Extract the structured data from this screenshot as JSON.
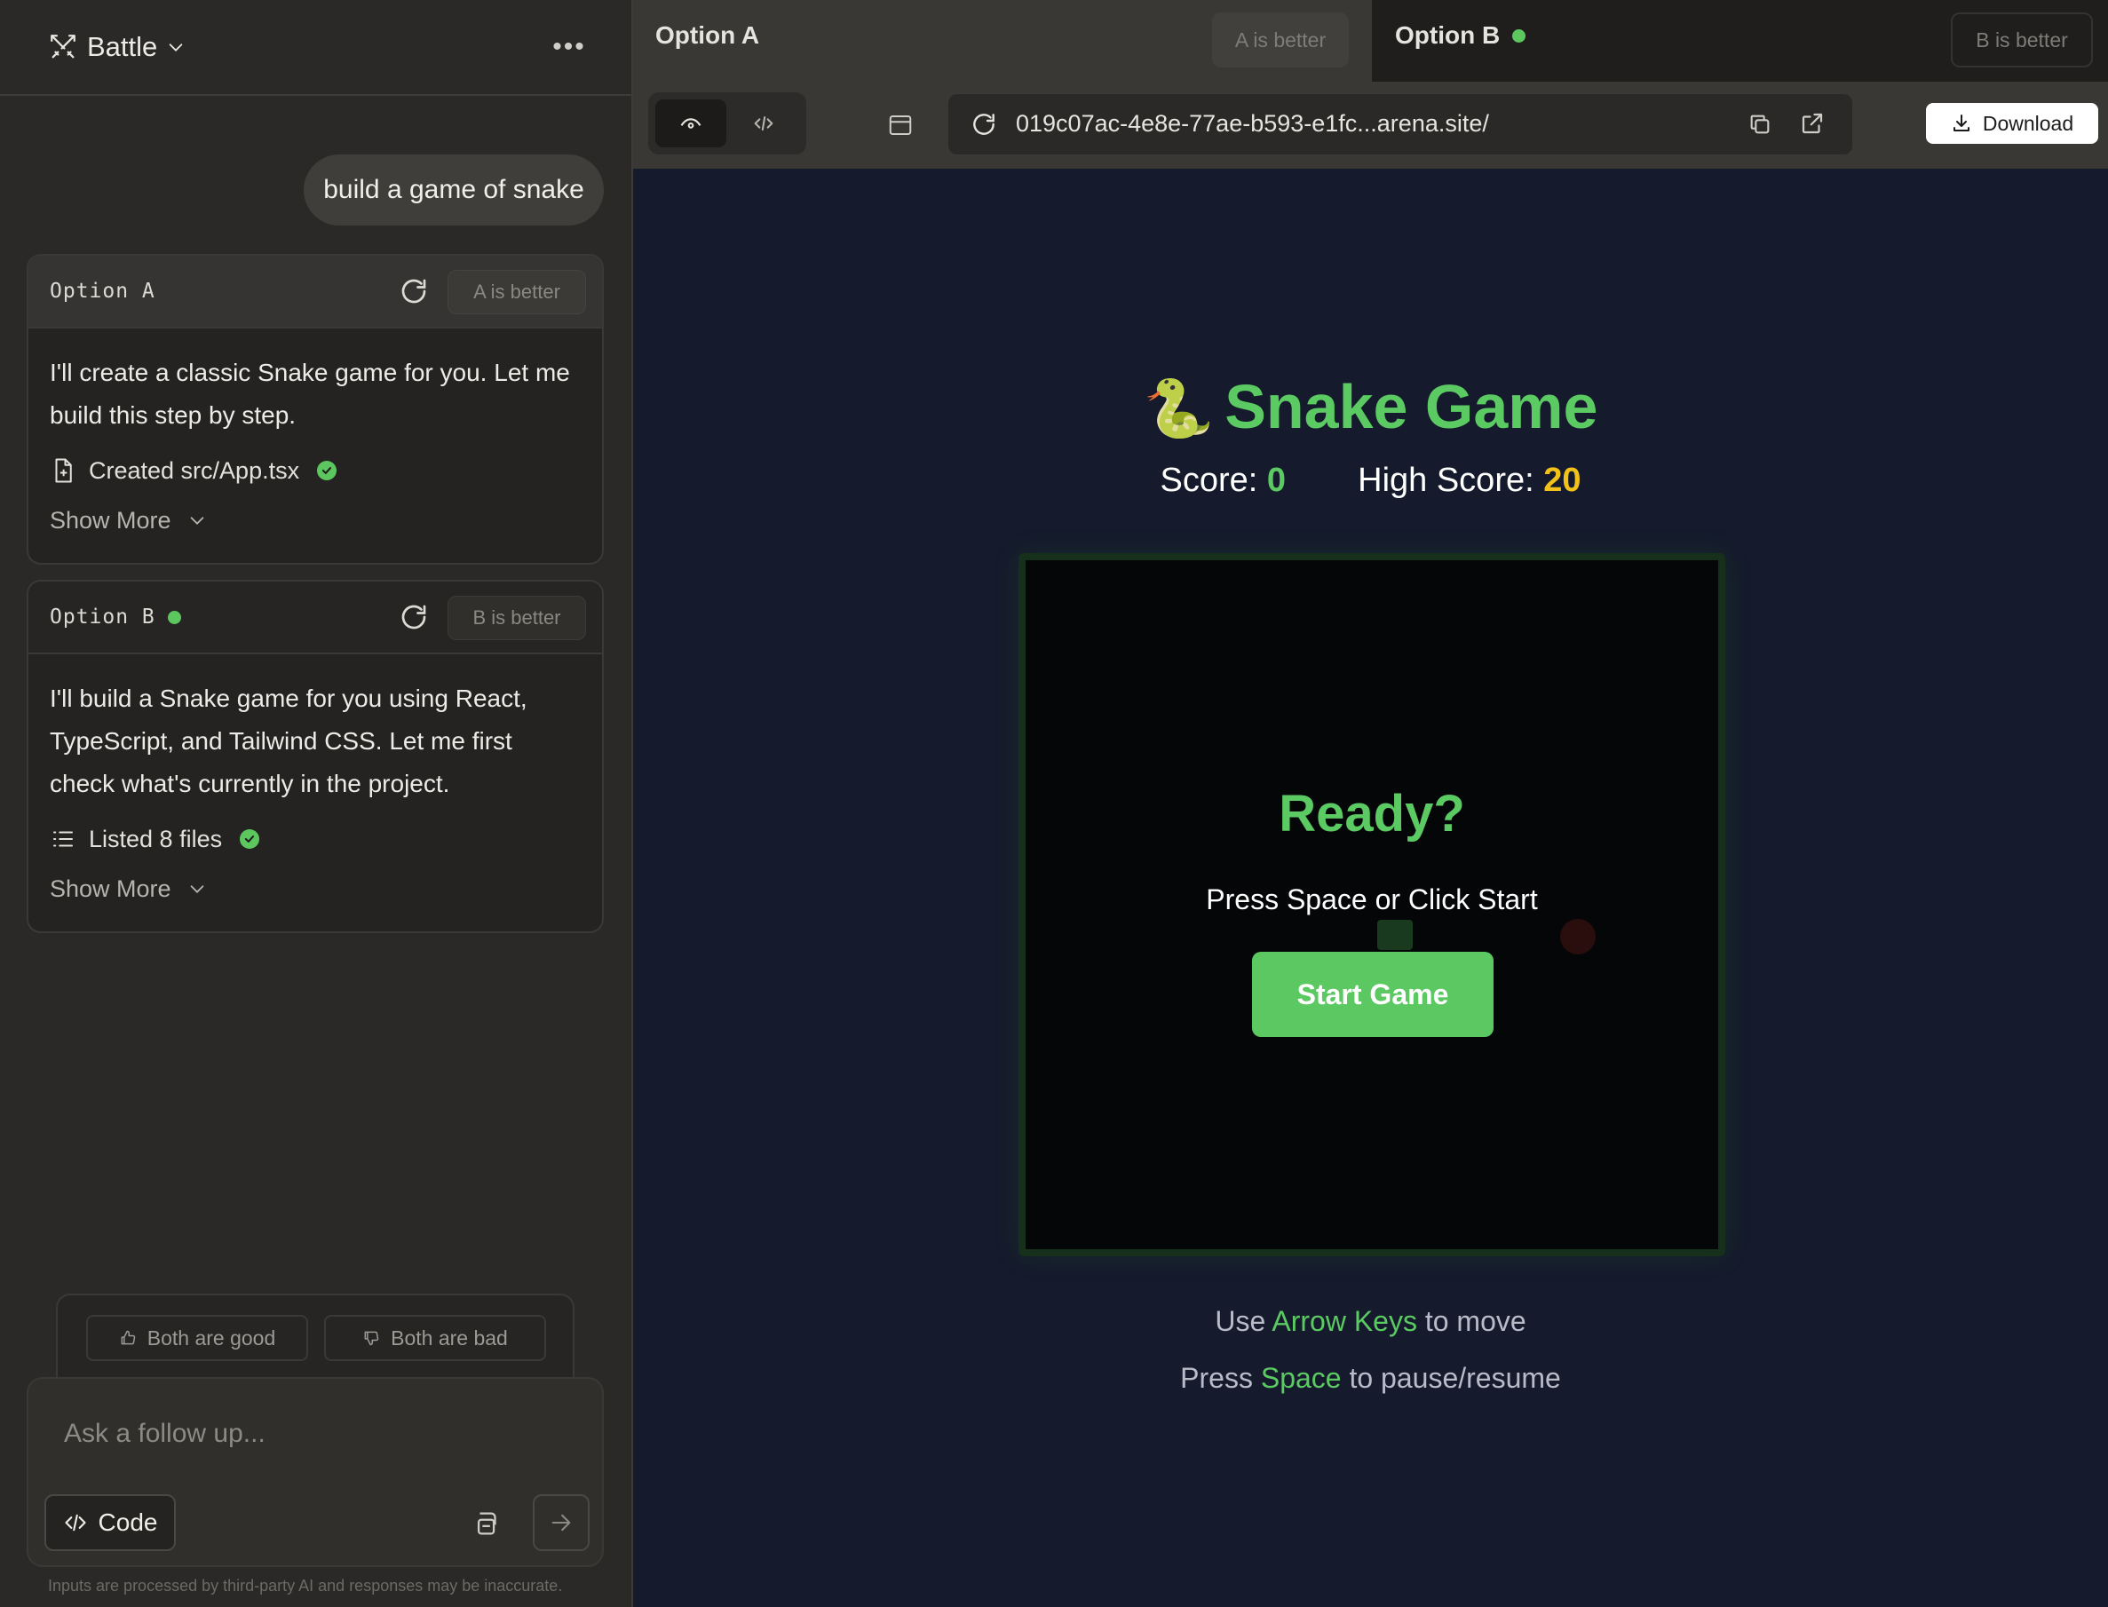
{
  "header": {
    "mode_label": "Battle",
    "more_label": "•••"
  },
  "chat": {
    "user_message": "build a game of snake",
    "option_a": {
      "title": "Option A",
      "better_label": "A is better",
      "message": "I'll create a classic Snake game for you. Let me build this step by step.",
      "tool_text": "Created src/App.tsx",
      "show_more": "Show More"
    },
    "option_b": {
      "title": "Option B",
      "better_label": "B is better",
      "message": "I'll build a Snake game for you using React, TypeScript, and Tailwind CSS. Let me first check what's currently in the project.",
      "tool_text": "Listed 8 files",
      "show_more": "Show More"
    },
    "vote": {
      "good_label": "Both are good",
      "bad_label": "Both are bad"
    },
    "input": {
      "placeholder": "Ask a follow up...",
      "code_label": "Code"
    },
    "disclaimer": "Inputs are processed by third-party AI and responses may be inaccurate."
  },
  "preview": {
    "tab_a": {
      "label": "Option A",
      "better_label": "A is better"
    },
    "tab_b": {
      "label": "Option B",
      "better_label": "B is better"
    },
    "url": "019c07ac-4e8e-77ae-b593-e1fc...arena.site/",
    "download_label": "Download"
  },
  "game": {
    "emoji": "🐍",
    "title": "Snake Game",
    "score_label": "Score:",
    "score_value": "0",
    "high_score_label": "High Score:",
    "high_score_value": "20",
    "ready_text": "Ready?",
    "press_text": "Press Space or Click Start",
    "start_label": "Start Game",
    "help1_prefix": "Use",
    "help1_highlight": "Arrow Keys",
    "help1_suffix": "to move",
    "help2_prefix": "Press",
    "help2_highlight": "Space",
    "help2_suffix": "to pause/resume"
  },
  "colors": {
    "accent_green": "#5bca62",
    "score_yellow": "#f2c21a",
    "stage_bg": "#151b2c",
    "panel_bg": "#2a2927"
  },
  "icons": [
    "swords-icon",
    "chevron-down-icon",
    "more-icon",
    "refresh-icon",
    "file-plus-icon",
    "check-icon",
    "list-icon",
    "thumbs-up-icon",
    "thumbs-down-icon",
    "code-icon",
    "attach-icon",
    "arrow-right-icon",
    "eye-icon",
    "panel-icon",
    "copy-icon",
    "external-link-icon",
    "download-icon",
    "snake-emoji"
  ]
}
